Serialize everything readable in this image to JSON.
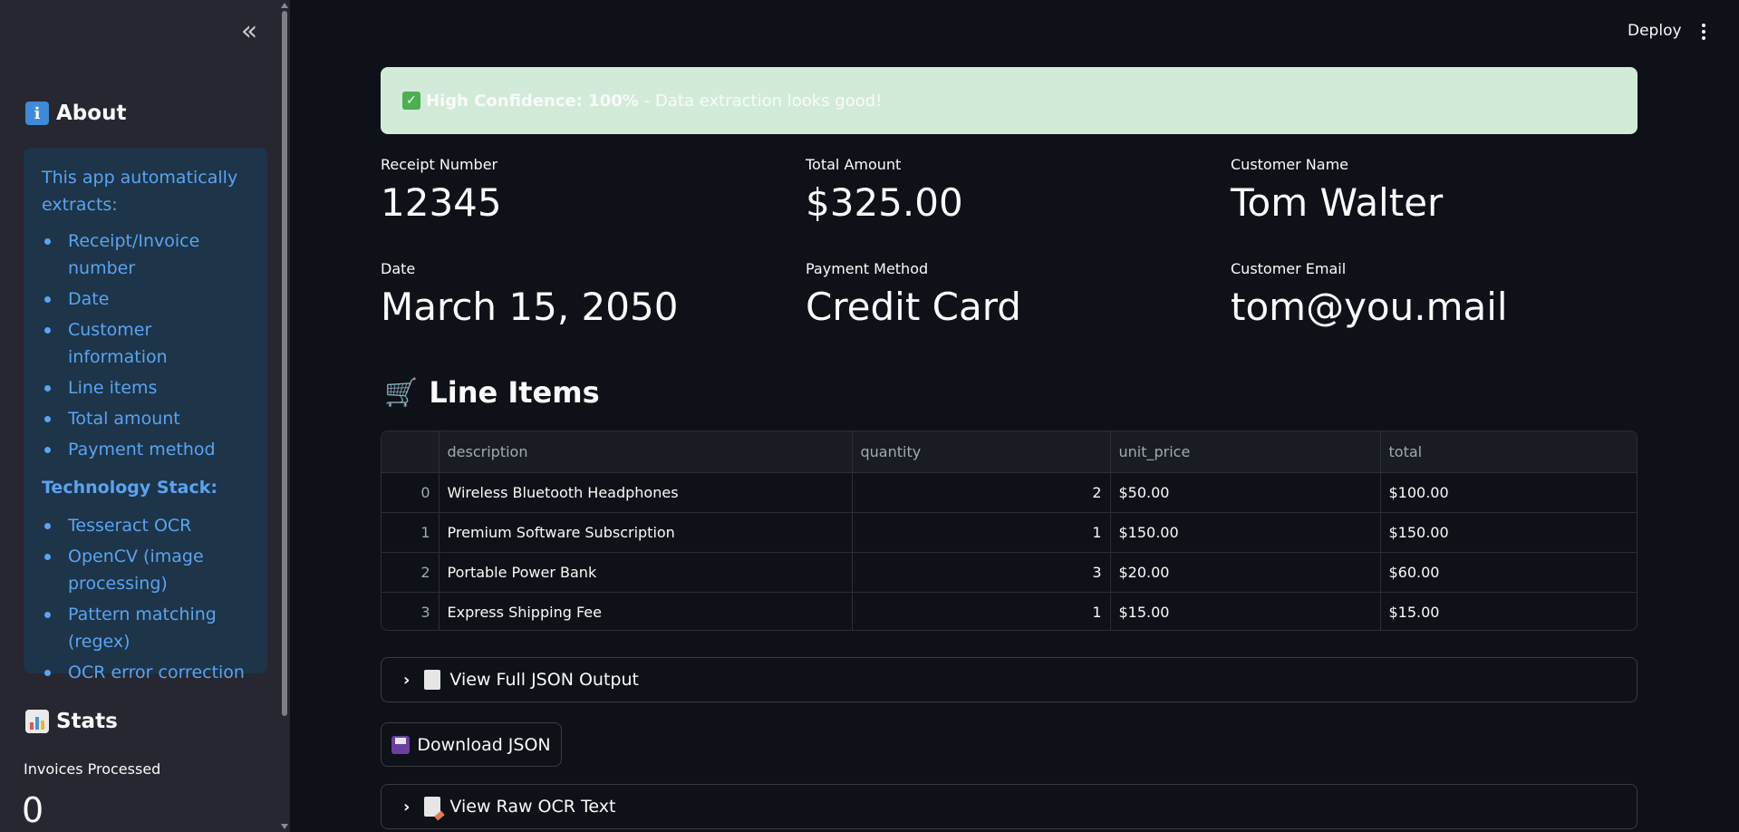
{
  "sidebar": {
    "collapse_glyph": "«",
    "about": {
      "icon_glyph": "i",
      "title": "About",
      "intro": "This app automatically extracts:",
      "items": [
        "Receipt/Invoice number",
        "Date",
        "Customer information",
        "Line items",
        "Total amount",
        "Payment method"
      ],
      "tech_heading": "Technology Stack:",
      "tech_items": [
        "Tesseract OCR",
        "OpenCV (image processing)",
        "Pattern matching (regex)",
        "OCR error correction"
      ]
    },
    "stats": {
      "title": "Stats",
      "label": "Invoices Processed",
      "value": "0"
    }
  },
  "header": {
    "deploy": "Deploy"
  },
  "alert": {
    "check_glyph": "✓",
    "bold": "High Confidence: 100%",
    "text": "- Data extraction looks good!"
  },
  "metrics": {
    "receipt_number": {
      "label": "Receipt Number",
      "value": "12345"
    },
    "total_amount": {
      "label": "Total Amount",
      "value": "$325.00"
    },
    "customer_name": {
      "label": "Customer Name",
      "value": "Tom Walter"
    },
    "date": {
      "label": "Date",
      "value": "March 15, 2050"
    },
    "payment_method": {
      "label": "Payment Method",
      "value": "Credit Card"
    },
    "customer_email": {
      "label": "Customer Email",
      "value": "tom@you.mail"
    }
  },
  "line_items": {
    "title": "Line Items",
    "cart_glyph": "🛒",
    "columns": [
      "",
      "description",
      "quantity",
      "unit_price",
      "total"
    ],
    "rows": [
      [
        "0",
        "Wireless Bluetooth Headphones",
        "2",
        "$50.00",
        "$100.00"
      ],
      [
        "1",
        "Premium Software Subscription",
        "1",
        "$150.00",
        "$150.00"
      ],
      [
        "2",
        "Portable Power Bank",
        "3",
        "$20.00",
        "$60.00"
      ],
      [
        "3",
        "Express Shipping Fee",
        "1",
        "$15.00",
        "$15.00"
      ]
    ]
  },
  "actions": {
    "chevron_glyph": "›",
    "json_expander": "View Full JSON Output",
    "download_json": "Download JSON",
    "raw_ocr_expander": "View Raw OCR Text"
  },
  "colors": {
    "background": "#0e1117",
    "sidebar": "#262730",
    "info_box": "#1d3449",
    "info_text": "#5aa4f0",
    "success_bg": "#d2ebd9"
  }
}
